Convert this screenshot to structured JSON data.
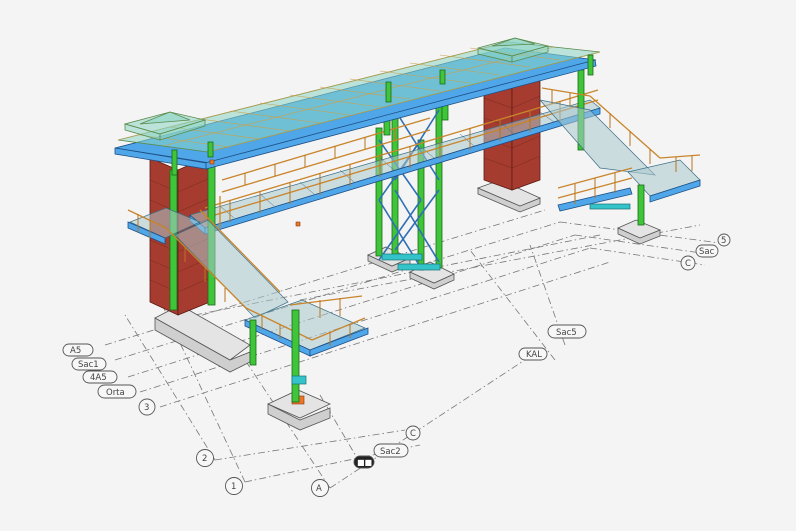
{
  "grid_labels_left": [
    "A5",
    "Sac1",
    "4A5",
    "Orta",
    "3"
  ],
  "grid_labels_bottom": [
    "2",
    "1",
    "A"
  ],
  "grid_labels_bottom_right": [
    "■■",
    "Sac2",
    "C"
  ],
  "grid_labels_center_right": [
    "KAL",
    "Sac5"
  ],
  "grid_labels_far_right": [
    "C",
    "Sac",
    "5"
  ],
  "colors": {
    "steel_beam": "#4fa6e8",
    "steel_column": "#3fc43a",
    "brick_tower": "#a63c30",
    "handrail": "#c9852b",
    "roof_glass": "#8cd6c4",
    "footing": "#cfcfcf",
    "base_plate": "#e87628",
    "bracket": "#34c3c9"
  }
}
